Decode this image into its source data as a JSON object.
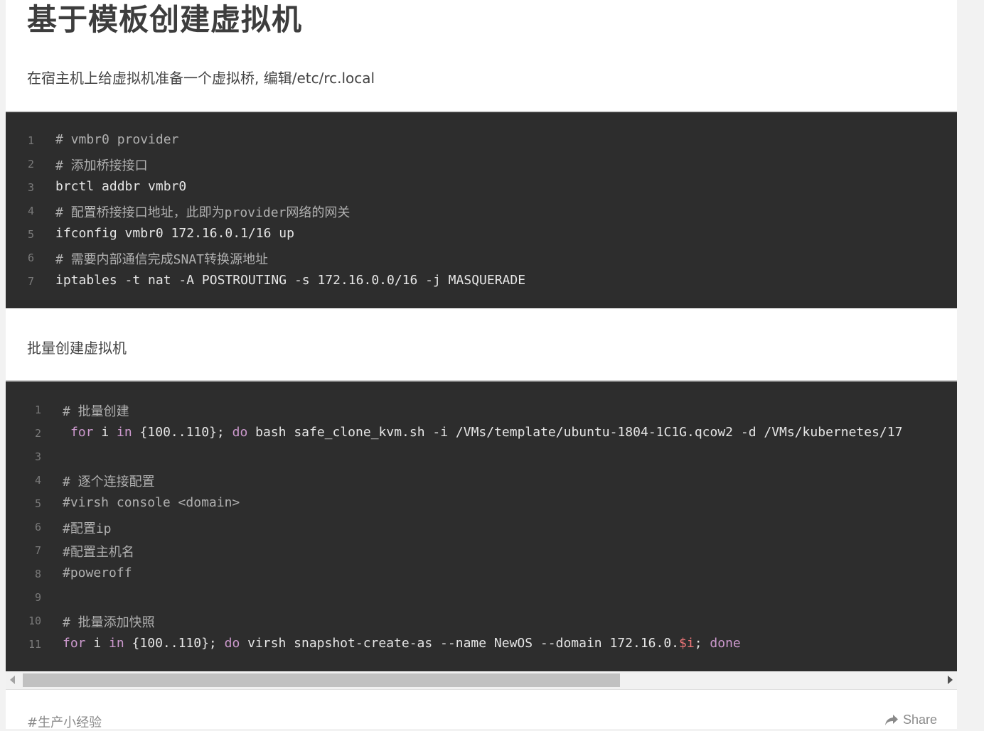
{
  "article": {
    "title": "基于模板创建虚拟机",
    "intro": "在宿主机上给虚拟机准备一个虚拟桥, 编辑/etc/rc.local",
    "section2": "批量创建虚拟机",
    "tag": "#生产小经验",
    "share_label": "Share"
  },
  "code1": {
    "line_numbers": [
      "1",
      "2",
      "3",
      "4",
      "5",
      "6",
      "7"
    ],
    "lines": [
      "# vmbr0 provider",
      "# 添加桥接接口",
      "brctl addbr vmbr0",
      "# 配置桥接接口地址，此即为provider网络的网关",
      "ifconfig vmbr0 172.16.0.1/16 up",
      "# 需要内部通信完成SNAT转换源地址",
      "iptables -t nat -A POSTROUTING -s 172.16.0.0/16 -j MASQUERADE"
    ]
  },
  "code2": {
    "line_numbers": [
      "1",
      "2",
      "3",
      "4",
      "5",
      "6",
      "7",
      "8",
      "9",
      "10",
      "11"
    ],
    "lines": {
      "l1": "# 批量创建",
      "l2": {
        "kw_for": "for",
        "a": " i ",
        "kw_in": "in",
        "b": " {100..110}; ",
        "kw_do": "do",
        "c": " bash safe_clone_kvm.sh -i /VMs/template/ubuntu-1804-1C1G.qcow2 -d /VMs/kubernetes/17"
      },
      "l3": "",
      "l4": "# 逐个连接配置",
      "l5": "#virsh console <domain>",
      "l6": "#配置ip",
      "l7": "#配置主机名",
      "l8": "#poweroff",
      "l9": "",
      "l10": "# 批量添加快照",
      "l11": {
        "kw_for": "for",
        "a": " i ",
        "kw_in": "in",
        "b": " {100..110}; ",
        "kw_do": "do",
        "c": " virsh snapshot-create-as --name NewOS --domain 172.16.0.",
        "var": "$i",
        "d": "; ",
        "kw_done": "done"
      }
    }
  },
  "colors": {
    "code_bg": "#2d2d2d",
    "keyword": "#cc99cd",
    "variable": "#f2777a",
    "comment": "#b0b0b0"
  },
  "icons": {
    "share": "share-arrow-icon",
    "scroll_left": "chevron-left-icon",
    "scroll_right": "chevron-right-icon"
  }
}
